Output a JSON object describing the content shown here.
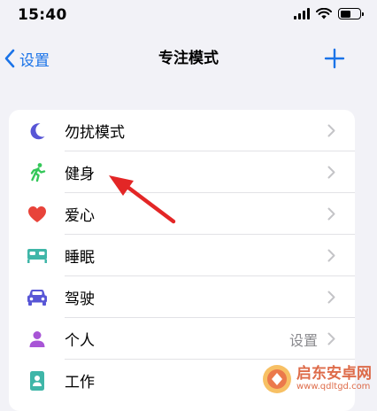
{
  "status_bar": {
    "time": "15:40"
  },
  "nav": {
    "back_label": "设置",
    "title": "专注模式"
  },
  "focus_modes": [
    {
      "label": "勿扰模式",
      "icon": "moon-icon",
      "color": "#5856d6"
    },
    {
      "label": "健身",
      "icon": "running-figure-icon",
      "color": "#34c759"
    },
    {
      "label": "爱心",
      "icon": "heart-icon",
      "color": "#e8433a"
    },
    {
      "label": "睡眠",
      "icon": "bed-icon",
      "color": "#3fb6a8"
    },
    {
      "label": "驾驶",
      "icon": "car-icon",
      "color": "#5856d6"
    },
    {
      "label": "个人",
      "icon": "person-icon",
      "color": "#a855d6",
      "detail": "设置"
    },
    {
      "label": "工作",
      "icon": "id-badge-icon",
      "color": "#3fb6a8"
    }
  ],
  "watermark": {
    "title": "启东安卓网",
    "url": "www.qdltgd.com"
  },
  "colors": {
    "accent": "#1a73e8",
    "annotation_arrow": "#e32626",
    "background": "#f2f2f7"
  }
}
